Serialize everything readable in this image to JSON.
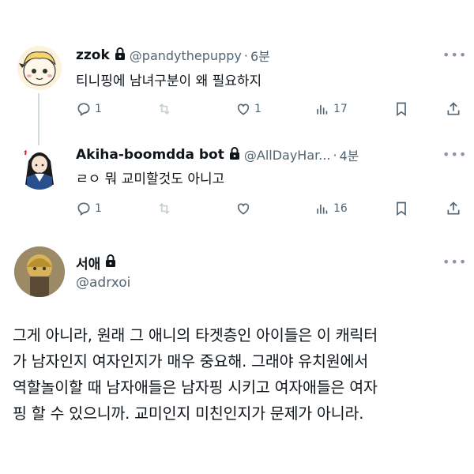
{
  "tweets": [
    {
      "display_name": "zzok",
      "handle": "@pandythepuppy",
      "separator": "·",
      "time": "6분",
      "text": "티니핑에 남녀구분이 왜 필요하지",
      "actions": {
        "reply": "1",
        "retweet": "",
        "like": "1",
        "views": "17"
      }
    },
    {
      "display_name": "Akiha-boomdda bot",
      "handle": "@AllDayHar...",
      "separator": "·",
      "time": "4분",
      "text": "ㄹㅇ 뭐 교미할것도 아니고",
      "actions": {
        "reply": "1",
        "retweet": "",
        "like": "",
        "views": "16"
      }
    }
  ],
  "main_tweet": {
    "display_name": "서애",
    "handle": "@adrxoi",
    "lines": [
      "그게 아니라, 원래 그 애니의 타겟층인 아이들은 이 캐릭터",
      "가 남자인지 여자인지가 매우 중요해. 그래야 유치원에서",
      "역할놀이할 때 남자애들은 남자핑 시키고 여자애들은 여자",
      "핑 할 수 있으니까. 교미인지 미친인지가 문제가 아니라."
    ]
  },
  "more_label": "•••",
  "icons": [
    "lock-icon",
    "reply-icon",
    "retweet-icon",
    "like-icon",
    "views-icon",
    "bookmark-icon",
    "share-icon",
    "more-icon"
  ],
  "colors": {
    "text": "#0f1419",
    "secondary": "#536471",
    "thread_line": "#cfd9de"
  }
}
